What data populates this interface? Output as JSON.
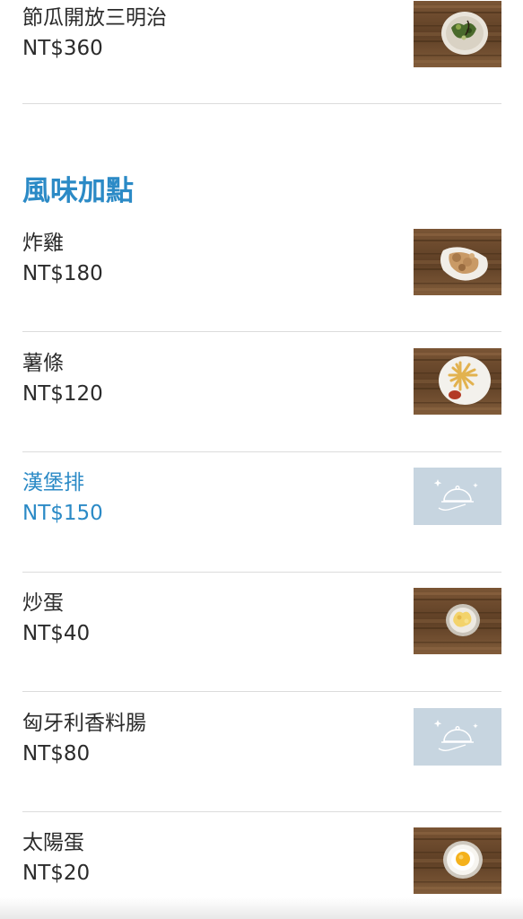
{
  "top_item": {
    "name": "節瓜開放三明治",
    "price": "NT$360"
  },
  "section": {
    "title": "風味加點"
  },
  "items": [
    {
      "name": "炸雞",
      "price": "NT$180",
      "image": "fried-chicken-photo"
    },
    {
      "name": "薯條",
      "price": "NT$120",
      "image": "french-fries-photo"
    },
    {
      "name": "漢堡排",
      "price": "NT$150",
      "image": "placeholder-cloche-icon"
    },
    {
      "name": "炒蛋",
      "price": "NT$40",
      "image": "scrambled-eggs-photo"
    },
    {
      "name": "匈牙利香料腸",
      "price": "NT$80",
      "image": "placeholder-cloche-icon"
    },
    {
      "name": "太陽蛋",
      "price": "NT$20",
      "image": "fried-egg-photo"
    }
  ],
  "colors": {
    "accent": "#2b8ac6",
    "text": "#2b2b2b",
    "placeholder_bg": "#c7d5e0",
    "wood": "#6b4a2e"
  }
}
